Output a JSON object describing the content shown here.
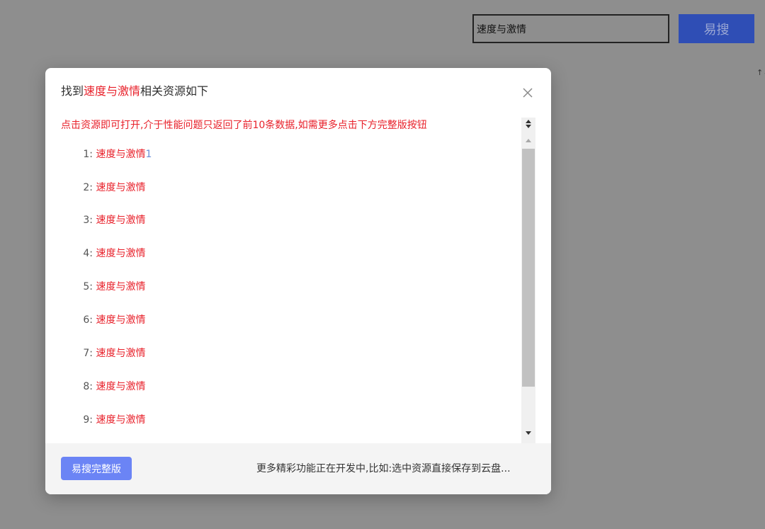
{
  "search": {
    "value": "速度与激情",
    "button_label": "易搜"
  },
  "corner_glyph": "↑↓",
  "modal": {
    "title_prefix": "找到",
    "title_keyword": "速度与激情",
    "title_suffix": "相关资源如下",
    "notice": "点击资源即可打开,介于性能问题只返回了前10条数据,如需更多点击下方完整版按钮",
    "results": [
      {
        "index": "1:",
        "title": "速度与激情",
        "suffix": "1"
      },
      {
        "index": "2:",
        "title": "速度与激情",
        "suffix": ""
      },
      {
        "index": "3:",
        "title": "速度与激情",
        "suffix": ""
      },
      {
        "index": "4:",
        "title": "速度与激情",
        "suffix": ""
      },
      {
        "index": "5:",
        "title": "速度与激情",
        "suffix": ""
      },
      {
        "index": "6:",
        "title": "速度与激情",
        "suffix": ""
      },
      {
        "index": "7:",
        "title": "速度与激情",
        "suffix": ""
      },
      {
        "index": "8:",
        "title": "速度与激情",
        "suffix": ""
      },
      {
        "index": "9:",
        "title": "速度与激情",
        "suffix": ""
      }
    ],
    "footer": {
      "full_button_label": "易搜完整版",
      "more_text": "更多精彩功能正在开发中,比如:选中资源直接保存到云盘..."
    }
  },
  "colors": {
    "keyword": "#e8202a",
    "primary_button": "#2f4eb5",
    "full_button": "#6b84f5"
  }
}
